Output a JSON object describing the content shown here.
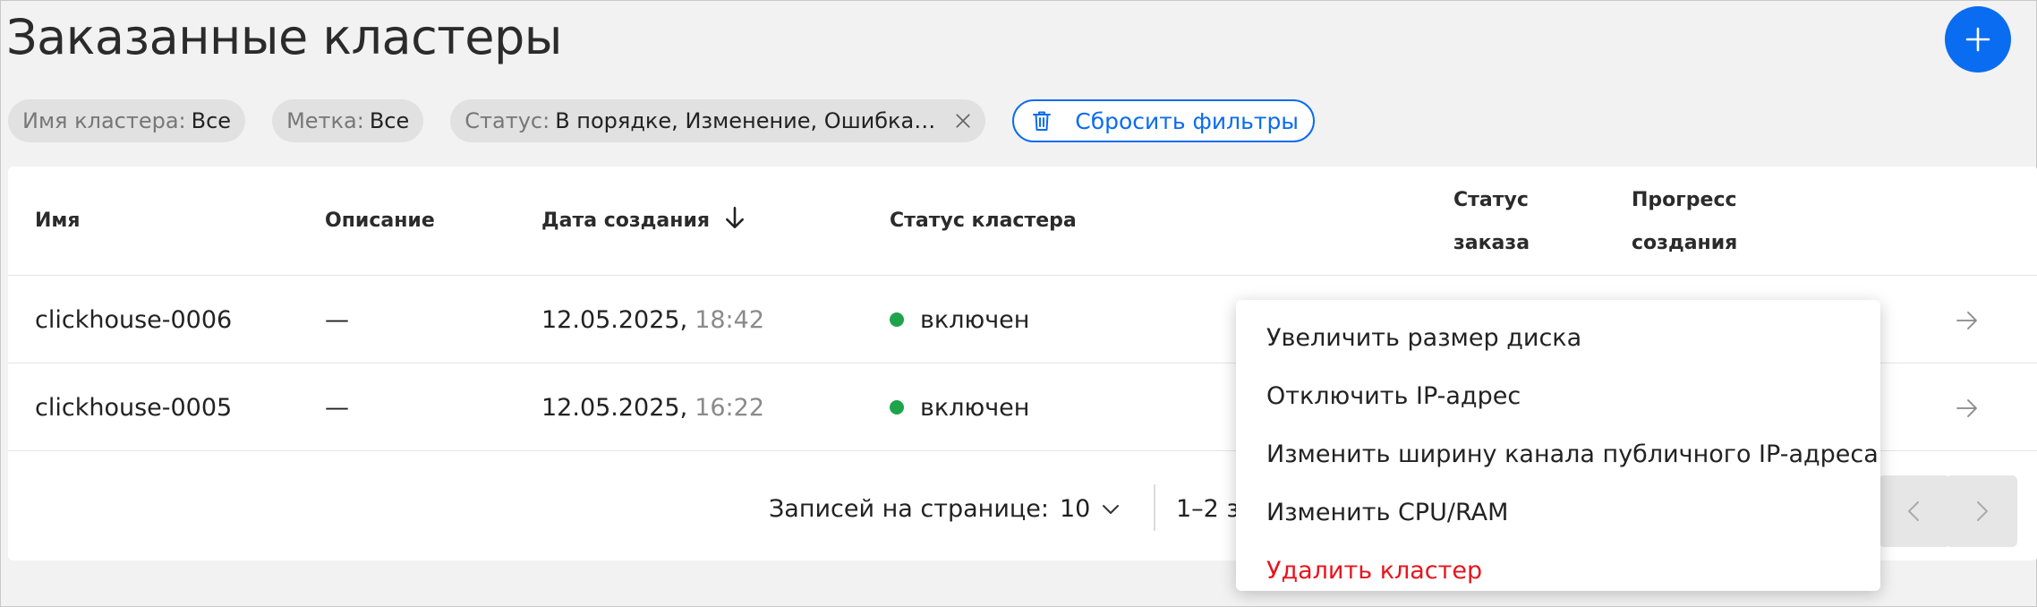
{
  "page": {
    "title": "Заказанные кластеры"
  },
  "filters": {
    "cluster_name": {
      "key": "Имя кластера:",
      "value": "Все"
    },
    "label": {
      "key": "Метка:",
      "value": "Все"
    },
    "status": {
      "key": "Статус:",
      "value": "В порядке, Изменение, Ошибка, В ..."
    },
    "reset_label": "Сбросить фильтры"
  },
  "table": {
    "headers": {
      "name": "Имя",
      "description": "Описание",
      "created": "Дата создания",
      "cluster_status": "Статус кластера",
      "order_status_1": "Статус",
      "order_status_2": "заказа",
      "progress_1": "Прогресс",
      "progress_2": "создания"
    },
    "rows": [
      {
        "name": "clickhouse-0006",
        "description": "—",
        "date": "12.05.2025,",
        "time": "18:42",
        "status": "включен"
      },
      {
        "name": "clickhouse-0005",
        "description": "—",
        "date": "12.05.2025,",
        "time": "16:22",
        "status": "включен"
      }
    ]
  },
  "pagination": {
    "per_page_label": "Записей на странице:",
    "per_page_value": "10",
    "range_text": "1–2 з"
  },
  "context_menu": {
    "items": [
      {
        "label": "Увеличить размер диска"
      },
      {
        "label": "Отключить IP-адрес"
      },
      {
        "label": "Изменить ширину канала публичного IP-адреса"
      },
      {
        "label": "Изменить CPU/RAM"
      },
      {
        "label": "Удалить кластер"
      }
    ]
  },
  "colors": {
    "accent": "#0a6cf0",
    "status_ok": "#1fa34a",
    "danger": "#e8141e"
  },
  "icons": {
    "add": "plus-icon",
    "clear": "close-icon",
    "reset": "trash-icon",
    "sort": "arrow-down-icon",
    "open": "arrow-right-icon",
    "dropdown": "chevron-down-icon",
    "prev": "chevron-left-icon",
    "next": "chevron-right-icon"
  }
}
